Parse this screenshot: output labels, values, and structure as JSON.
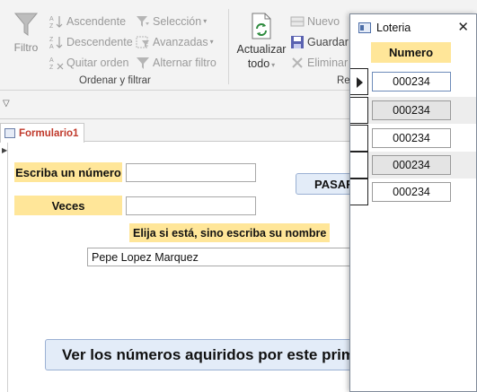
{
  "ribbon": {
    "filter": {
      "label": "Filtro",
      "icon": "funnel-icon"
    },
    "sort": [
      {
        "label": "Ascendente",
        "icon": "sort-ascending-icon"
      },
      {
        "label": "Descendente",
        "icon": "sort-descending-icon"
      },
      {
        "label": "Quitar orden",
        "icon": "remove-sort-icon"
      }
    ],
    "selection": [
      {
        "label": "Selección",
        "icon": "selection-filter-icon",
        "dropdown": true
      },
      {
        "label": "Avanzadas",
        "icon": "advanced-filter-icon",
        "dropdown": true
      },
      {
        "label": "Alternar filtro",
        "icon": "toggle-filter-icon",
        "dropdown": false
      }
    ],
    "group_label": "Ordenar y filtrar",
    "refresh": {
      "line1": "Actualizar",
      "line2": "todo",
      "icon": "refresh-icon"
    },
    "records": [
      {
        "label": "Nuevo",
        "icon": "new-record-icon",
        "enabled": false
      },
      {
        "label": "Guardar",
        "icon": "save-icon",
        "enabled": true
      },
      {
        "label": "Eliminar",
        "icon": "delete-icon",
        "enabled": false
      }
    ],
    "records_group_label": "Re"
  },
  "document_tab": {
    "label": "Formulario1"
  },
  "form": {
    "number_label": "Escriba un número",
    "number_value": "",
    "times_label": "Veces",
    "times_value": "",
    "pass_button": "PASAR",
    "hint": "Elija si está, sino escriba su nombre",
    "name_value": "Pepe Lopez Marquez",
    "view_button": "Ver los números aquiridos por este prime"
  },
  "popup": {
    "title": "Loteria",
    "column_header": "Numero",
    "records": [
      "000234",
      "000234",
      "000234",
      "000234",
      "000234"
    ],
    "active_index": 0
  },
  "colors": {
    "label_bg": "#ffe699",
    "button_bg": "#e3ecf8",
    "tab_text": "#c0392b"
  }
}
